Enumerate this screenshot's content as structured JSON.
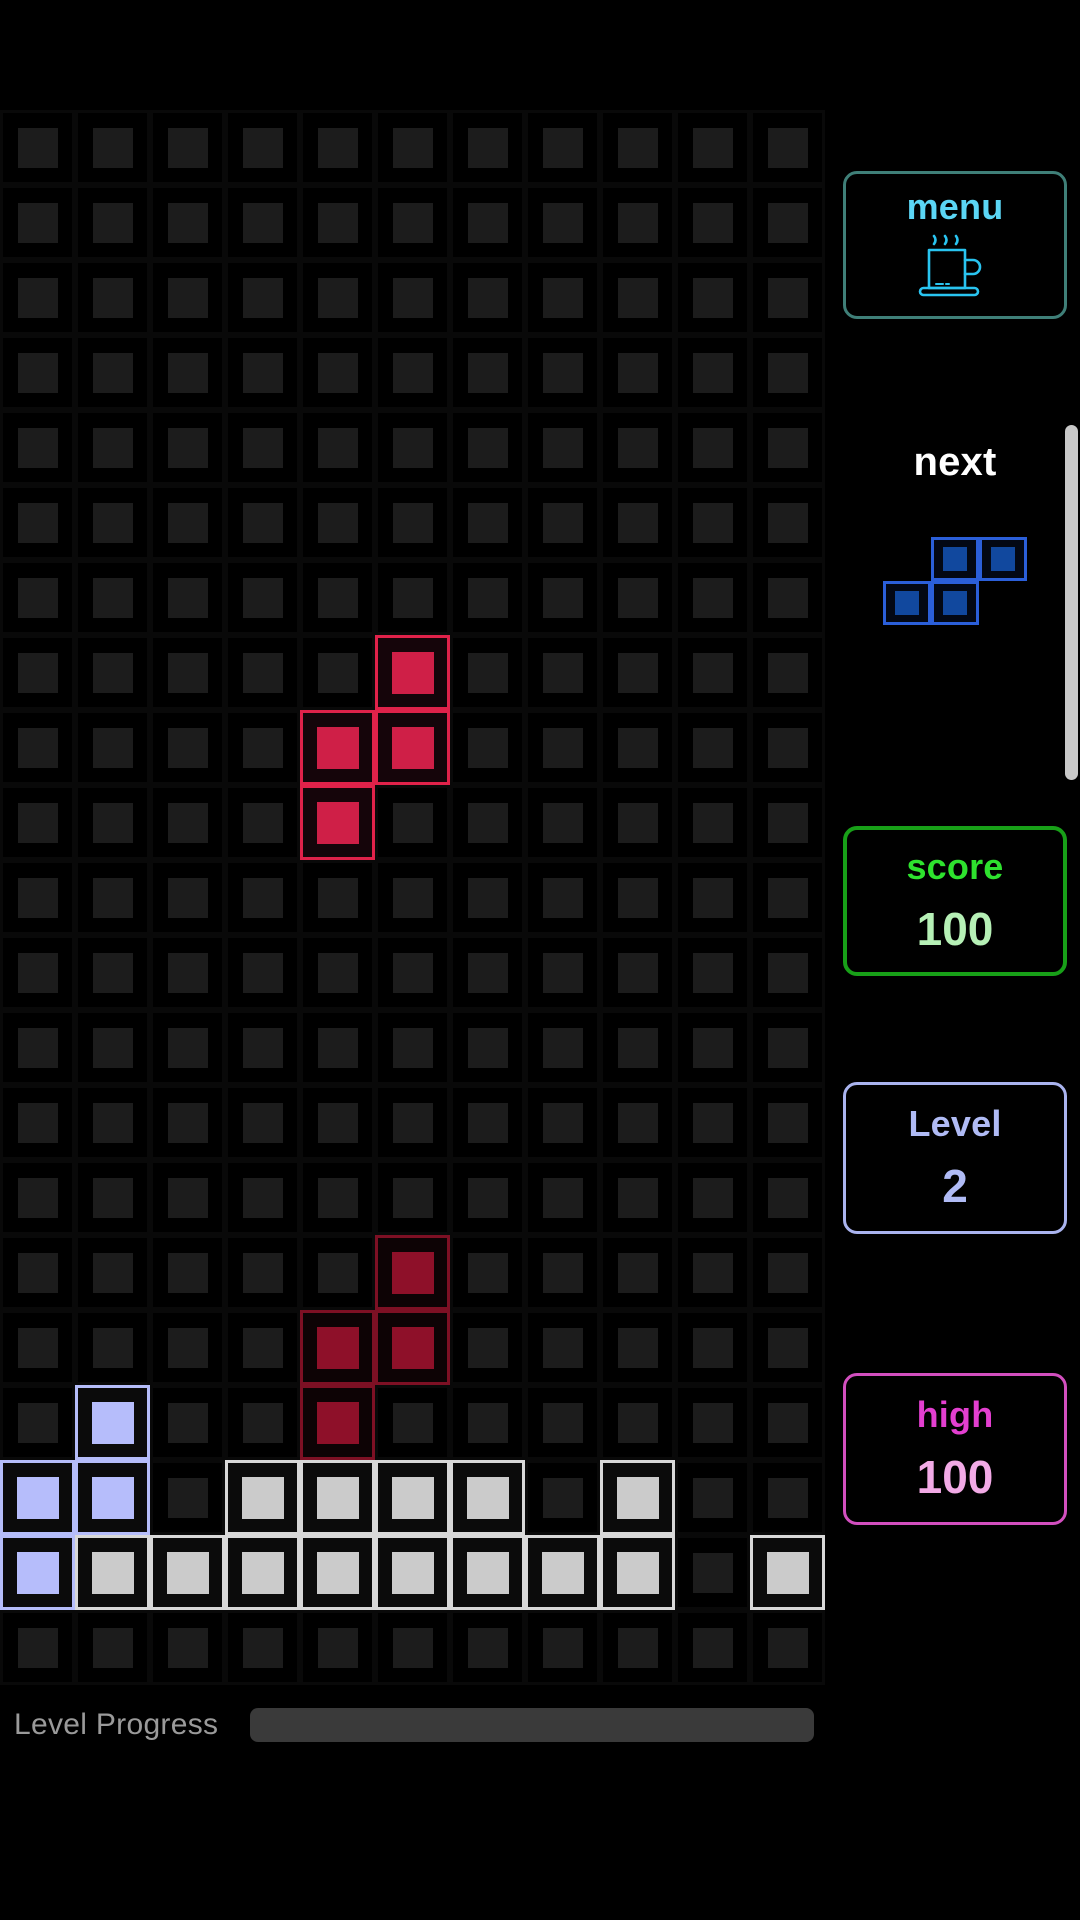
{
  "app": {
    "title": "Tetris"
  },
  "board": {
    "columns": 11,
    "rows": 21,
    "cell_size_px": 75,
    "colors": {
      "empty_border": "#090909",
      "empty_pip": "#1c1c1c",
      "active_border": "#e0224a",
      "active_pip": "#cf1f47",
      "ghost_border": "#7d1024",
      "ghost_pip": "#8e1029",
      "lavender_border": "#b5bdfa",
      "lavender_pip": "#b6bdfb",
      "white_border": "#d8d8d8",
      "white_pip": "#cbcbcb"
    },
    "active_piece": {
      "name": "S-piece",
      "color": "#cf1f47",
      "cells": [
        [
          7,
          5
        ],
        [
          8,
          4
        ],
        [
          8,
          5
        ],
        [
          9,
          4
        ]
      ]
    },
    "ghost_piece": {
      "name": "S-piece-ghost",
      "color": "#8e1029",
      "cells": [
        [
          15,
          5
        ],
        [
          16,
          4
        ],
        [
          16,
          5
        ],
        [
          17,
          4
        ]
      ]
    },
    "locked": [
      {
        "row": 17,
        "col": 1,
        "color": "lavender"
      },
      {
        "row": 18,
        "col": 0,
        "color": "lavender"
      },
      {
        "row": 18,
        "col": 1,
        "color": "lavender"
      },
      {
        "row": 18,
        "col": 3,
        "color": "white"
      },
      {
        "row": 18,
        "col": 4,
        "color": "white"
      },
      {
        "row": 18,
        "col": 5,
        "color": "white"
      },
      {
        "row": 18,
        "col": 6,
        "color": "white"
      },
      {
        "row": 18,
        "col": 8,
        "color": "white"
      },
      {
        "row": 19,
        "col": 0,
        "color": "lavender"
      },
      {
        "row": 19,
        "col": 1,
        "color": "white"
      },
      {
        "row": 19,
        "col": 2,
        "color": "white"
      },
      {
        "row": 19,
        "col": 3,
        "color": "white"
      },
      {
        "row": 19,
        "col": 4,
        "color": "white"
      },
      {
        "row": 19,
        "col": 5,
        "color": "white"
      },
      {
        "row": 19,
        "col": 6,
        "color": "white"
      },
      {
        "row": 19,
        "col": 7,
        "color": "white"
      },
      {
        "row": 19,
        "col": 8,
        "color": "white"
      },
      {
        "row": 19,
        "col": 10,
        "color": "white"
      }
    ]
  },
  "progress": {
    "label": "Level Progress",
    "percent": 0,
    "track_color": "#3a3a3a"
  },
  "sidebar": {
    "menu": {
      "title": "menu",
      "icon": "coffee-mug-icon",
      "border_color": "#3f7f78",
      "text_color": "#5bd6f5"
    },
    "next": {
      "title": "next",
      "piece_name": "S-piece",
      "piece_color": "#2b5fd9",
      "piece_cells": [
        [
          0,
          1
        ],
        [
          0,
          2
        ],
        [
          1,
          0
        ],
        [
          1,
          1
        ]
      ]
    },
    "score": {
      "title": "score",
      "value": "100",
      "border_color": "#18a018",
      "title_color": "#2ee22e",
      "value_color": "#b6f0b6"
    },
    "level": {
      "title": "Level",
      "value": "2",
      "border_color": "#aab4ef",
      "title_color": "#b0bbf5",
      "value_color": "#b0bbf5"
    },
    "high": {
      "title": "high",
      "value": "100",
      "border_color": "#d24fbf",
      "title_color": "#e33fd0",
      "value_color": "#f2aae6"
    }
  },
  "scrollbar": {
    "thumb_color": "#c8c8c8"
  }
}
